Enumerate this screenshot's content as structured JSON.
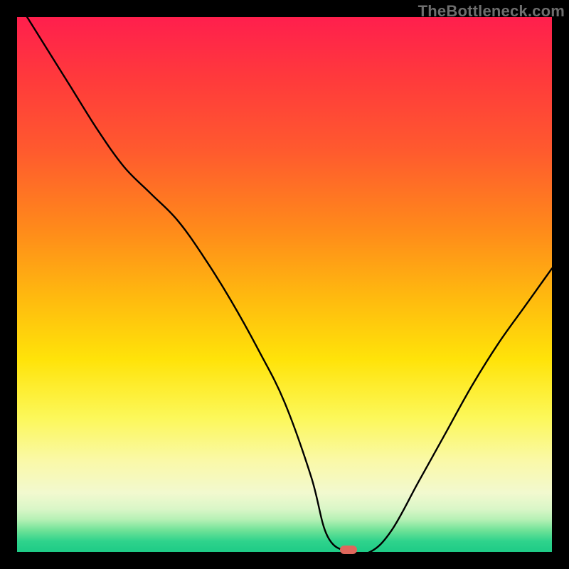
{
  "watermark": "TheBottleneck.com",
  "marker": {
    "x_frac": 0.62,
    "y_frac": 0.996
  },
  "chart_data": {
    "type": "line",
    "title": "",
    "xlabel": "",
    "ylabel": "",
    "xlim": [
      0,
      1
    ],
    "ylim": [
      0,
      1
    ],
    "x": [
      0.0,
      0.05,
      0.1,
      0.15,
      0.2,
      0.25,
      0.3,
      0.35,
      0.4,
      0.45,
      0.5,
      0.55,
      0.58,
      0.62,
      0.66,
      0.7,
      0.75,
      0.8,
      0.85,
      0.9,
      0.95,
      1.0
    ],
    "values": [
      1.03,
      0.95,
      0.87,
      0.79,
      0.72,
      0.67,
      0.62,
      0.55,
      0.47,
      0.38,
      0.28,
      0.14,
      0.03,
      0.0,
      0.0,
      0.04,
      0.13,
      0.22,
      0.31,
      0.39,
      0.46,
      0.53
    ],
    "marker_x": 0.62,
    "marker_y": 0.0,
    "gradient_stops": [
      {
        "pos": 0.0,
        "color": "#ff1f4d"
      },
      {
        "pos": 0.5,
        "color": "#ffd500"
      },
      {
        "pos": 0.85,
        "color": "#f8f9b0"
      },
      {
        "pos": 1.0,
        "color": "#1ecb86"
      }
    ]
  }
}
